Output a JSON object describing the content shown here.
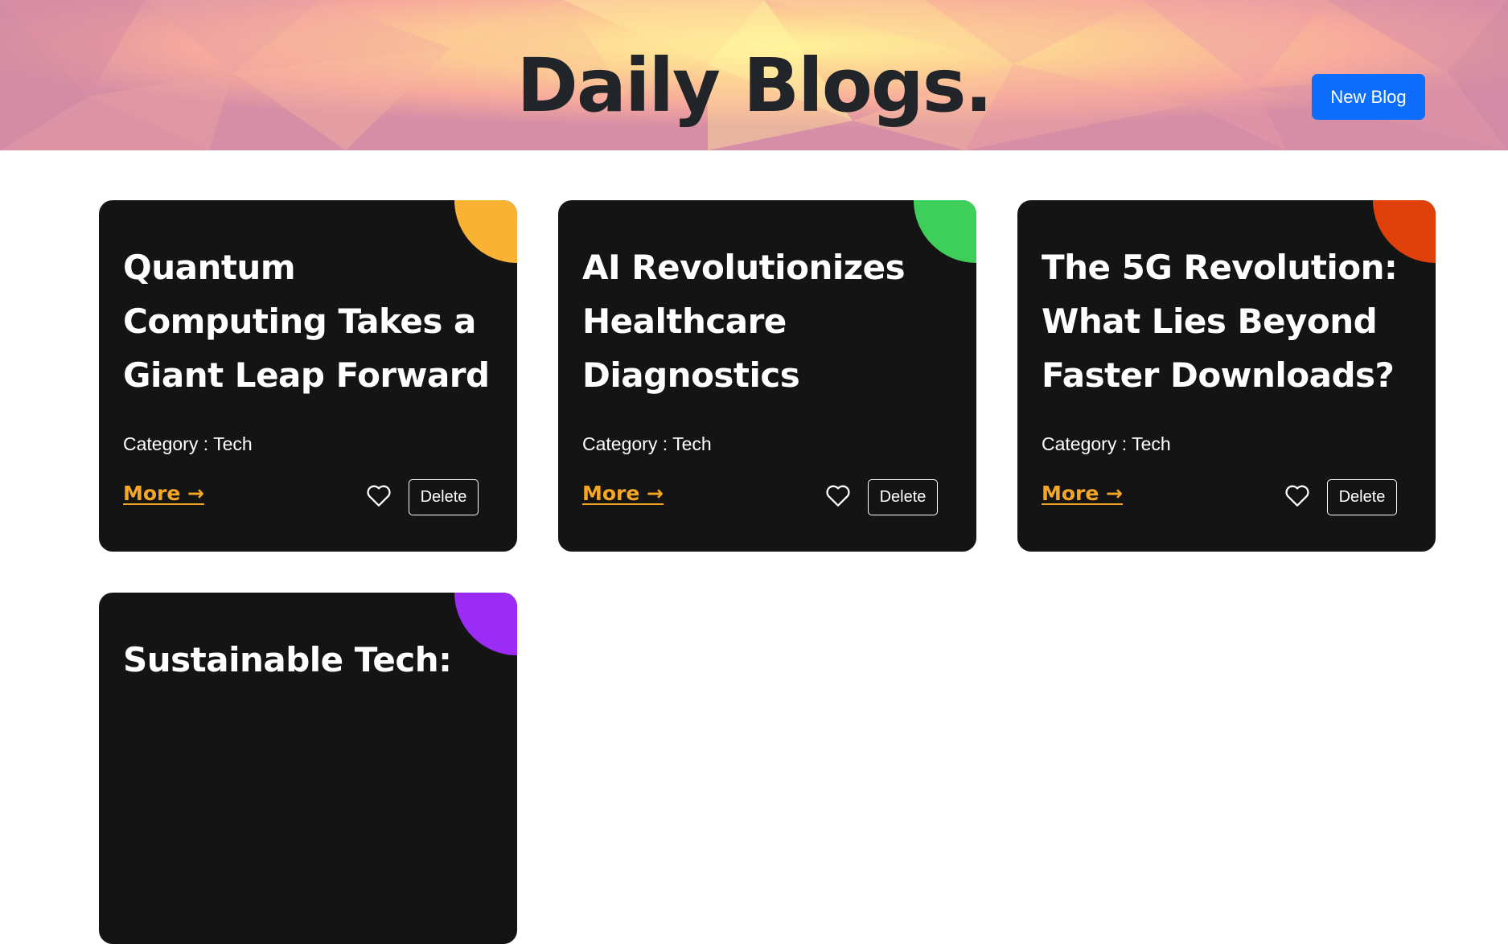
{
  "header": {
    "title": "Daily Blogs.",
    "new_blog_label": "New Blog"
  },
  "colors": {
    "primary": "#0d6efd",
    "card_background": "#141414",
    "more_link": "#f5a623"
  },
  "posts": [
    {
      "title": "Quantum Computing Takes a Giant Leap Forward",
      "category": "Category : Tech",
      "more_label": "More →",
      "delete_label": "Delete",
      "accent_color": "#f9b233",
      "liked": false
    },
    {
      "title": "AI Revolutionizes Healthcare Diagnostics",
      "category": "Category : Tech",
      "more_label": "More →",
      "delete_label": "Delete",
      "accent_color": "#3ecf5a",
      "liked": false
    },
    {
      "title": "The 5G Revolution: What Lies Beyond Faster Downloads?",
      "category": "Category : Tech",
      "more_label": "More →",
      "delete_label": "Delete",
      "accent_color": "#e0400a",
      "liked": false
    },
    {
      "title": "Sustainable Tech:",
      "accent_color": "#9b2cf5"
    }
  ]
}
